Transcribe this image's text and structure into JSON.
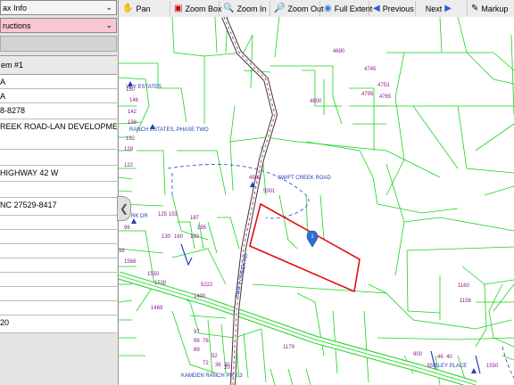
{
  "left_panel": {
    "select_info": "ax Info",
    "select_instructions": "ructions",
    "item_header": "em #1",
    "rows": [
      "A",
      "A",
      "8-8278",
      "REEK ROAD-LAN DEVELOPMENT,",
      "",
      "HIGHWAY 42 W",
      "",
      "NC 27529-8417",
      "",
      "",
      "",
      "",
      "",
      "",
      "",
      "20"
    ]
  },
  "toolbar": {
    "pan": "Pan",
    "zoom_box": "Zoom Box",
    "zoom_in": "Zoom In",
    "zoom_out": "Zoom Out",
    "full_extent": "Full Extent",
    "previous": "Previous",
    "next": "Next",
    "markup": "Markup"
  },
  "map": {
    "marker_label": "1",
    "road_labels": {
      "swift_creek_rd": "SWIFT CREEK RD",
      "swift_creek_road": "SWIFT CREEK ROAD",
      "subdivision_estates": "VEY ESTATES",
      "ranch_estates": "RANCH ESTATES, PHASE TWO",
      "kamden": "KAMDEN RANCH PH 2 3",
      "isley_place": "ISLEY PLACE",
      "dr": "RK DR"
    },
    "parcel_numbers": [
      "4690",
      "4745",
      "4753",
      "4795",
      "4765",
      "4800",
      "150",
      "146",
      "142",
      "138",
      "132",
      "128",
      "122",
      "4982",
      "5001",
      "119",
      "125",
      "153",
      "187",
      "195",
      "96",
      "130",
      "160",
      "182",
      "98",
      "1568",
      "1550",
      "1530",
      "5222",
      "1400",
      "1469",
      "1179",
      "1160",
      "1156",
      "97",
      "98",
      "76",
      "89",
      "52",
      "72",
      "36",
      "30",
      "20",
      "900",
      "35",
      "46",
      "40",
      "1550"
    ],
    "colors": {
      "parcel_line": "#19d419",
      "selected_parcel": "#e01010",
      "road_casing": "#3a3a3a",
      "road_center": "#c23c6b",
      "label": "#8b1a8b",
      "marker": "#2a6fd6"
    }
  }
}
